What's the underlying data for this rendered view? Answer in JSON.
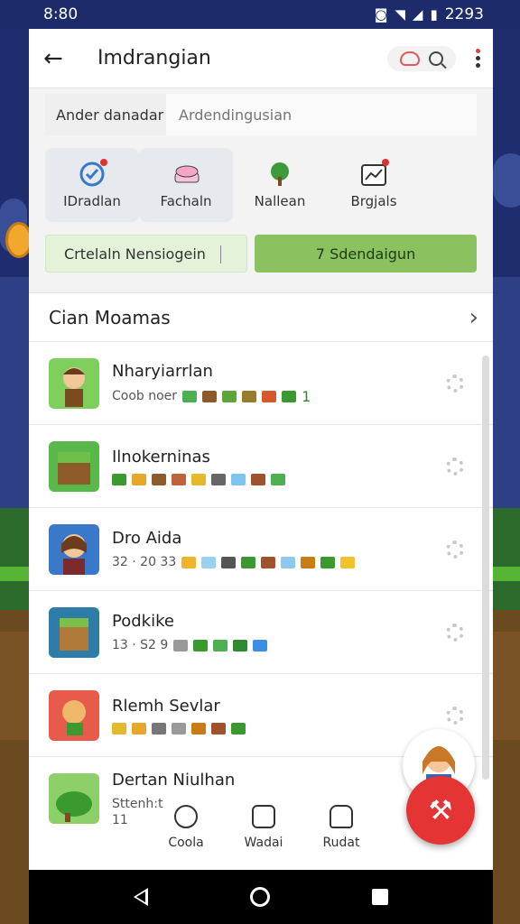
{
  "status_bar": {
    "time": "8:80",
    "battery": "2293"
  },
  "app_bar": {
    "title": "Imdrangian"
  },
  "search": {
    "label": "Ander danadar",
    "placeholder": "Ardendingusian"
  },
  "categories": [
    {
      "label": "IDradlan",
      "icon": "target-icon",
      "selected": true,
      "badge": true
    },
    {
      "label": "Fachaln",
      "icon": "cake-icon",
      "selected": true,
      "badge": false
    },
    {
      "label": "Nallean",
      "icon": "tree-icon",
      "selected": false,
      "badge": false
    },
    {
      "label": "Brgjals",
      "icon": "chart-icon",
      "selected": false,
      "badge": true
    }
  ],
  "buttons": {
    "primary_light": "Crtelaln Nensiogein",
    "primary_green": "7 Sdendaigun"
  },
  "section": {
    "title": "Cian Moamas"
  },
  "list": [
    {
      "title": "Nharyiarrlan",
      "meta": "Coob noer",
      "suffix": "1"
    },
    {
      "title": "Ilnokerninas",
      "meta": "",
      "suffix": ""
    },
    {
      "title": "Dro Aida",
      "meta": "32 · 20 33",
      "suffix": ""
    },
    {
      "title": "Podkike",
      "meta": "13 · S2 9",
      "suffix": ""
    },
    {
      "title": "Rlemh Sevlar",
      "meta": "",
      "suffix": ""
    },
    {
      "title": "Dertan Niulhan",
      "meta": "Sttenh:t",
      "suffix": "11"
    }
  ],
  "bottom_tabs": [
    {
      "label": "Coola"
    },
    {
      "label": "Wadai"
    },
    {
      "label": "Rudat"
    }
  ],
  "colors": {
    "accent_green": "#8cc15f",
    "fab_red": "#e43434"
  }
}
